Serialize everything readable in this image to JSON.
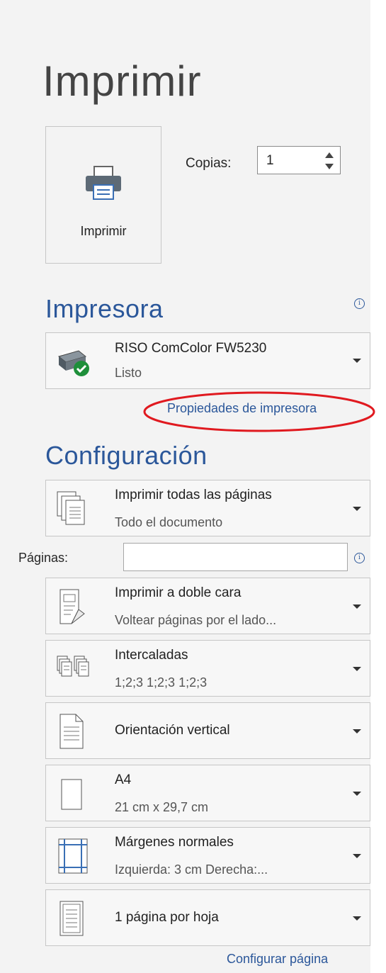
{
  "page": {
    "title": "Imprimir"
  },
  "print_button": {
    "label": "Imprimir",
    "icon": "printer-icon"
  },
  "copies": {
    "label": "Copias:",
    "value": "1"
  },
  "printer_section": {
    "title": "Impresora",
    "printer": {
      "name": "RISO ComColor FW5230",
      "status": "Listo",
      "icon": "printer-ready-icon"
    },
    "properties_link": "Propiedades de impresora",
    "highlight_color": "#e0191f"
  },
  "settings_section": {
    "title": "Configuración",
    "pages_label": "Páginas:",
    "pages_value": "",
    "items": [
      {
        "line1": "Imprimir todas las páginas",
        "line2": "Todo el documento",
        "icon": "all-pages-icon"
      },
      {
        "line1": "Imprimir a doble cara",
        "line2": "Voltear páginas por el lado...",
        "icon": "duplex-icon"
      },
      {
        "line1": "Intercaladas",
        "line2": "1;2;3    1;2;3    1;2;3",
        "icon": "collated-icon"
      },
      {
        "line1": "Orientación vertical",
        "line2": "",
        "icon": "portrait-icon"
      },
      {
        "line1": "A4",
        "line2": "21 cm x 29,7 cm",
        "icon": "paper-size-icon"
      },
      {
        "line1": "Márgenes normales",
        "line2": "Izquierda:  3 cm    Derecha:...",
        "icon": "margins-icon"
      },
      {
        "line1": "1 página por hoja",
        "line2": "",
        "icon": "pages-per-sheet-icon"
      }
    ],
    "page_setup_link": "Configurar página"
  },
  "colors": {
    "accent": "#2b579a",
    "background": "#f3f3f3",
    "ready_green": "#1e8f3a"
  }
}
